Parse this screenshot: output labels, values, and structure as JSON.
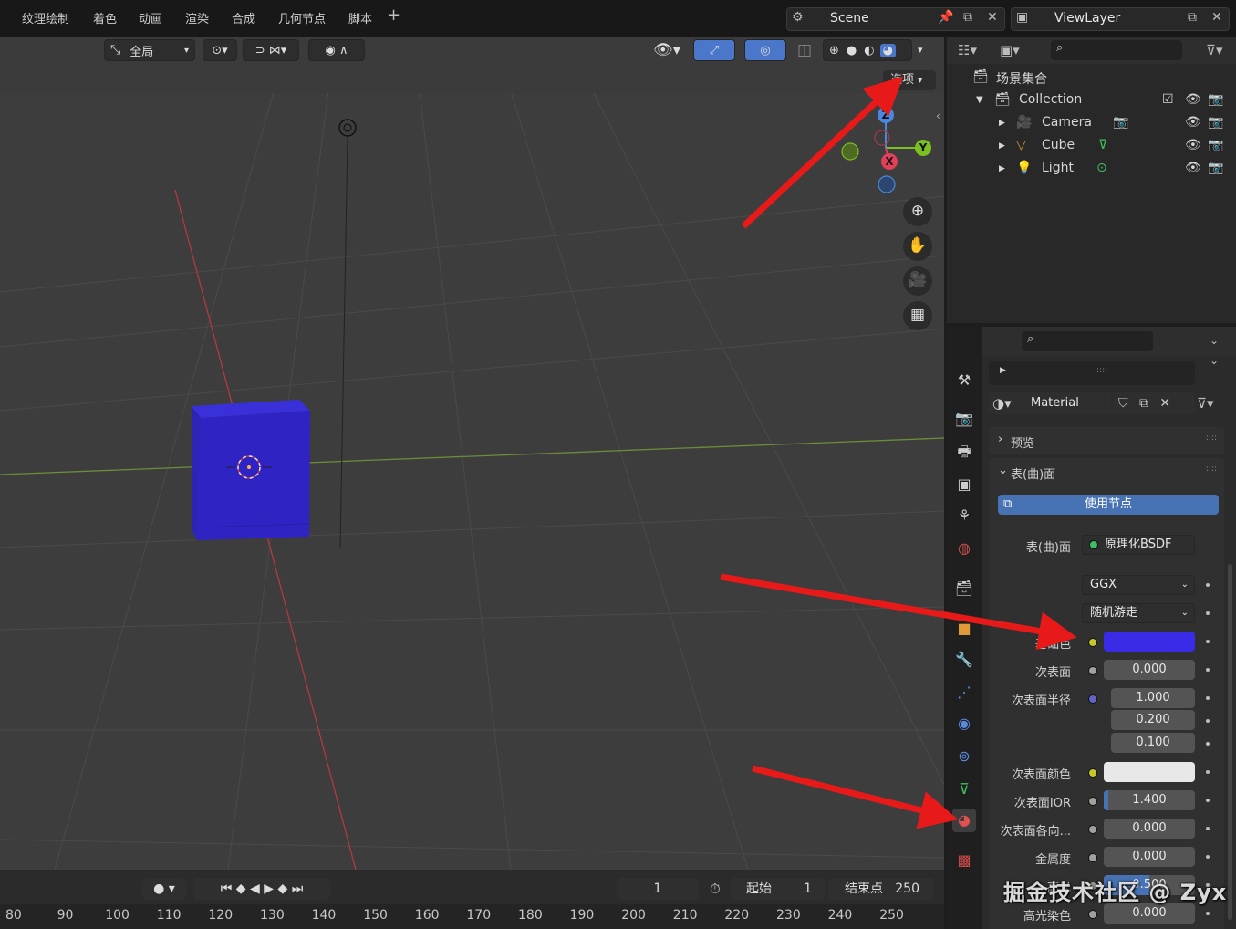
{
  "topbar": {
    "workspaces": [
      "纹理绘制",
      "着色",
      "动画",
      "渲染",
      "合成",
      "几何节点",
      "脚本"
    ],
    "add_label": "+",
    "scene_name": "Scene",
    "view_layer": "ViewLayer"
  },
  "viewport": {
    "orientation": "全局",
    "options_label": "选项",
    "gizmo_axes": {
      "z": "Z",
      "y": "Y",
      "x": "X"
    },
    "cube_color": "#2f23c4"
  },
  "outliner": {
    "scene_collection": "场景集合",
    "items": [
      {
        "name": "Collection"
      },
      {
        "name": "Camera"
      },
      {
        "name": "Cube"
      },
      {
        "name": "Light"
      }
    ]
  },
  "properties": {
    "material_name": "Material",
    "panels": {
      "preview": "预览",
      "surface": "表(曲)面"
    },
    "use_nodes": "使用节点",
    "surface_label": "表(曲)面",
    "surface_shader": "原理化BSDF",
    "distribution": "GGX",
    "subsurface_method": "随机游走",
    "rows": [
      {
        "label": "基础色",
        "value": ""
      },
      {
        "label": "次表面",
        "value": "0.000"
      },
      {
        "label": "次表面半径",
        "value": "1.000"
      },
      {
        "label": "",
        "value": "0.200"
      },
      {
        "label": "",
        "value": "0.100"
      },
      {
        "label": "次表面颜色",
        "value": ""
      },
      {
        "label": "次表面IOR",
        "value": "1.400"
      },
      {
        "label": "次表面各向...",
        "value": "0.000"
      },
      {
        "label": "金属度",
        "value": "0.000"
      },
      {
        "label": "高光",
        "value": "0.500"
      },
      {
        "label": "高光染色",
        "value": "0.000"
      }
    ],
    "base_color": "#3a2be6",
    "subsurface_color": "#e8e8e8",
    "ior_fill": 0.05
  },
  "timeline": {
    "current_frame": "1",
    "start_label": "起始",
    "start_value": "1",
    "end_label": "结束点",
    "end_value": "250",
    "ruler": [
      "80",
      "90",
      "100",
      "110",
      "120",
      "130",
      "140",
      "150",
      "160",
      "170",
      "180",
      "190",
      "200",
      "210",
      "220",
      "230",
      "240",
      "250"
    ]
  },
  "watermark": "掘金技术社区 @ Zyx"
}
